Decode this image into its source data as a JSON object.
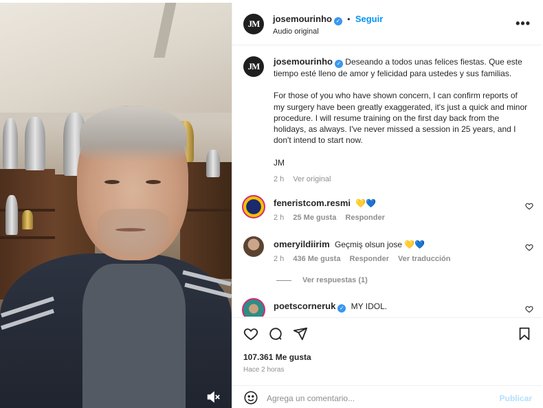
{
  "post": {
    "author": "josemourinho",
    "author_monogram": "JM",
    "follow_label": "Seguir",
    "audio_label": "Audio original",
    "more_label": "•••"
  },
  "caption": {
    "username": "josemourinho",
    "paragraph1": "Deseando a todos unas felices fiestas. Que este tiempo esté lleno de amor y felicidad para ustedes y sus familias.",
    "paragraph2": "For those of you who have shown concern, I can confirm reports of my surgery have been greatly exaggerated, it's just a quick and minor procedure. I will resume training on the first day back from the holidays, as always. I've never missed a session in 25 years, and I don't intend to start now.",
    "signature": "JM",
    "time": "2 h",
    "see_original": "Ver original"
  },
  "comments": [
    {
      "username": "feneristcom.resmi",
      "text": "💛💙",
      "time": "2 h",
      "likes": "25 Me gusta",
      "reply_label": "Responder",
      "translate_label": "",
      "verified": false
    },
    {
      "username": "omeryildiirim",
      "text": "Geçmiş olsun jose 💛💙",
      "time": "2 h",
      "likes": "436 Me gusta",
      "reply_label": "Responder",
      "translate_label": "Ver traducción",
      "verified": false
    },
    {
      "username": "poetscorneruk",
      "text": "MY IDOL.",
      "time": "",
      "likes": "",
      "reply_label": "",
      "translate_label": "",
      "verified": true
    }
  ],
  "view_replies_label": "Ver respuestas (1)",
  "footer": {
    "likes": "107.361 Me gusta",
    "time": "Hace 2 horas",
    "comment_placeholder": "Agrega un comentario...",
    "publish_label": "Publicar"
  },
  "icons": {
    "verified": "verified-badge-icon",
    "heart": "heart-icon",
    "comment": "comment-icon",
    "share": "share-icon",
    "save": "bookmark-icon",
    "emoji": "emoji-icon",
    "mute": "muted-speaker-icon"
  },
  "colors": {
    "link": "#0095f6",
    "verified": "#3897f0",
    "publish_disabled": "#b2dffc",
    "secondary_text": "#8e8e8e"
  }
}
